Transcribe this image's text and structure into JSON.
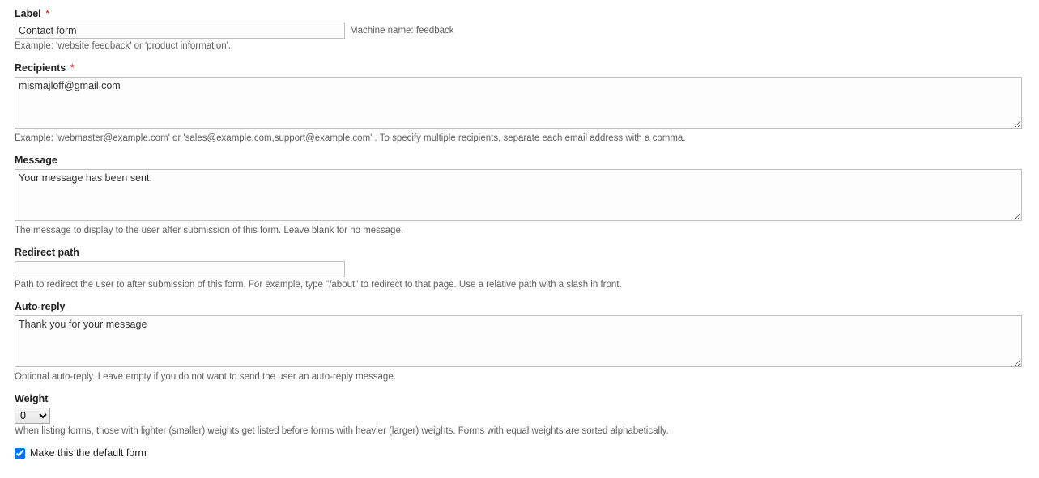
{
  "label_field": {
    "label": "Label",
    "required": "*",
    "value": "Contact form",
    "description": "Example: 'website feedback' or 'product information'."
  },
  "machine_name": {
    "prefix": "Machine name: ",
    "value": "feedback"
  },
  "recipients": {
    "label": "Recipients",
    "required": "*",
    "value": "mismajloff@gmail.com",
    "description": "Example: 'webmaster@example.com' or 'sales@example.com,support@example.com' . To specify multiple recipients, separate each email address with a comma."
  },
  "message": {
    "label": "Message",
    "value": "Your message has been sent.",
    "description": "The message to display to the user after submission of this form. Leave blank for no message."
  },
  "redirect_path": {
    "label": "Redirect path",
    "value": "",
    "description": "Path to redirect the user to after submission of this form. For example, type \"/about\" to redirect to that page. Use a relative path with a slash in front."
  },
  "auto_reply": {
    "label": "Auto-reply",
    "value": "Thank you for your message",
    "description": "Optional auto-reply. Leave empty if you do not want to send the user an auto-reply message."
  },
  "weight": {
    "label": "Weight",
    "value": "0",
    "description": "When listing forms, those with lighter (smaller) weights get listed before forms with heavier (larger) weights. Forms with equal weights are sorted alphabetically."
  },
  "default_form": {
    "label": "Make this the default form",
    "checked": true
  }
}
